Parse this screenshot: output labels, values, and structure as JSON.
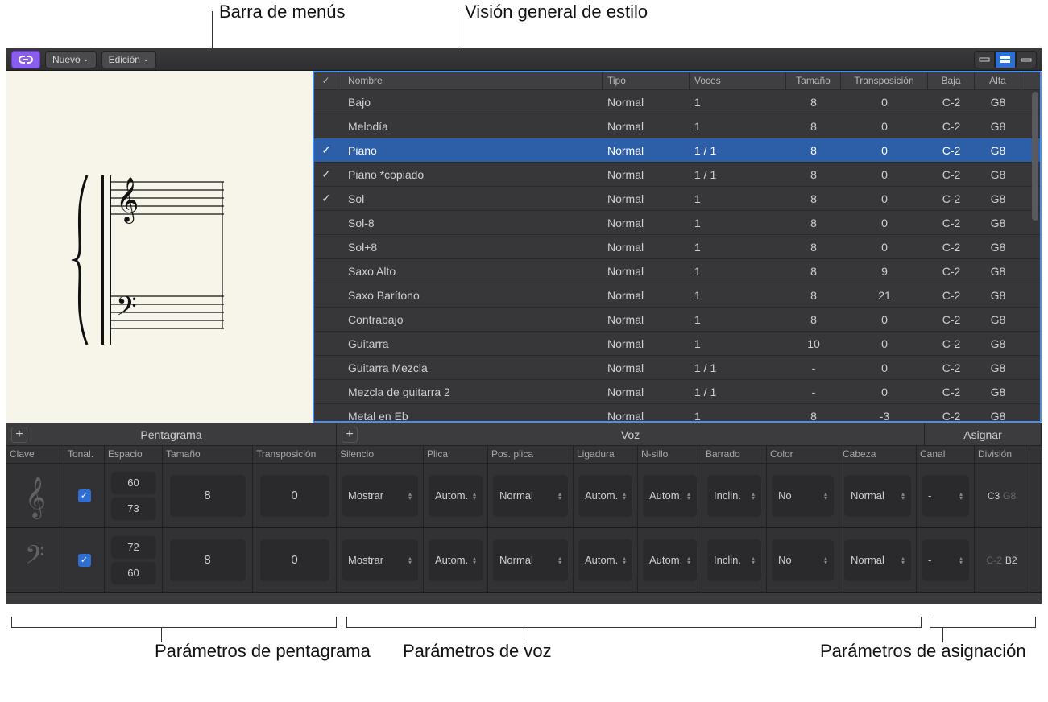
{
  "callouts": {
    "menubar": "Barra de menús",
    "style_overview": "Visión general de estilo",
    "staff_params": "Parámetros de pentagrama",
    "voice_params": "Parámetros de voz",
    "assign_params": "Parámetros de asignación"
  },
  "toolbar": {
    "nuevo": "Nuevo",
    "edicion": "Edición"
  },
  "styles": {
    "headers": {
      "check": "✓",
      "name": "Nombre",
      "type": "Tipo",
      "voices": "Voces",
      "size": "Tamaño",
      "trans": "Transposición",
      "low": "Baja",
      "high": "Alta"
    },
    "rows": [
      {
        "chk": "",
        "name": "Bajo",
        "type": "Normal",
        "voices": "1",
        "size": "8",
        "trans": "0",
        "low": "C-2",
        "high": "G8",
        "sel": false
      },
      {
        "chk": "",
        "name": "Melodía",
        "type": "Normal",
        "voices": "1",
        "size": "8",
        "trans": "0",
        "low": "C-2",
        "high": "G8",
        "sel": false
      },
      {
        "chk": "✓",
        "name": "Piano",
        "type": "Normal",
        "voices": "1 / 1",
        "size": "8",
        "trans": "0",
        "low": "C-2",
        "high": "G8",
        "sel": true
      },
      {
        "chk": "✓",
        "name": "Piano *copiado",
        "type": "Normal",
        "voices": "1 / 1",
        "size": "8",
        "trans": "0",
        "low": "C-2",
        "high": "G8",
        "sel": false
      },
      {
        "chk": "✓",
        "name": "Sol",
        "type": "Normal",
        "voices": "1",
        "size": "8",
        "trans": "0",
        "low": "C-2",
        "high": "G8",
        "sel": false
      },
      {
        "chk": "",
        "name": "Sol-8",
        "type": "Normal",
        "voices": "1",
        "size": "8",
        "trans": "0",
        "low": "C-2",
        "high": "G8",
        "sel": false
      },
      {
        "chk": "",
        "name": "Sol+8",
        "type": "Normal",
        "voices": "1",
        "size": "8",
        "trans": "0",
        "low": "C-2",
        "high": "G8",
        "sel": false
      },
      {
        "chk": "",
        "name": "Saxo Alto",
        "type": "Normal",
        "voices": "1",
        "size": "8",
        "trans": "9",
        "low": "C-2",
        "high": "G8",
        "sel": false
      },
      {
        "chk": "",
        "name": "Saxo Barítono",
        "type": "Normal",
        "voices": "1",
        "size": "8",
        "trans": "21",
        "low": "C-2",
        "high": "G8",
        "sel": false
      },
      {
        "chk": "",
        "name": "Contrabajo",
        "type": "Normal",
        "voices": "1",
        "size": "8",
        "trans": "0",
        "low": "C-2",
        "high": "G8",
        "sel": false
      },
      {
        "chk": "",
        "name": "Guitarra",
        "type": "Normal",
        "voices": "1",
        "size": "10",
        "trans": "0",
        "low": "C-2",
        "high": "G8",
        "sel": false
      },
      {
        "chk": "",
        "name": "Guitarra Mezcla",
        "type": "Normal",
        "voices": "1 / 1",
        "size": "-",
        "trans": "0",
        "low": "C-2",
        "high": "G8",
        "sel": false
      },
      {
        "chk": "",
        "name": "Mezcla de guitarra 2",
        "type": "Normal",
        "voices": "1 / 1",
        "size": "-",
        "trans": "0",
        "low": "C-2",
        "high": "G8",
        "sel": false
      },
      {
        "chk": "",
        "name": "Metal en Eb",
        "type": "Normal",
        "voices": "1",
        "size": "8",
        "trans": "-3",
        "low": "C-2",
        "high": "G8",
        "sel": false
      }
    ]
  },
  "sections": {
    "staff": "Pentagrama",
    "voice": "Voz",
    "assign": "Asignar"
  },
  "param_headers": {
    "clave": "Clave",
    "tonal": "Tonal.",
    "espacio": "Espacio",
    "tam": "Tamaño",
    "trp": "Transposición",
    "sil": "Silencio",
    "pli": "Plica",
    "pos": "Pos. plica",
    "lig": "Ligadura",
    "nsi": "N-sillo",
    "bar": "Barrado",
    "col": "Color",
    "cab": "Cabeza",
    "can": "Canal",
    "div": "División"
  },
  "param_rows": [
    {
      "clef": "treble",
      "tonal": true,
      "esp1": "60",
      "esp2": "73",
      "tam": "8",
      "trp": "0",
      "sil": "Mostrar",
      "pli": "Autom.",
      "pos": "Normal",
      "lig": "Autom.",
      "nsi": "Autom.",
      "bar": "Inclin.",
      "col": "No",
      "cab": "Normal",
      "can": "-",
      "div1": "C3",
      "div2": "G8",
      "div2dim": true
    },
    {
      "clef": "bass",
      "tonal": true,
      "esp1": "72",
      "esp2": "60",
      "tam": "8",
      "trp": "0",
      "sil": "Mostrar",
      "pli": "Autom.",
      "pos": "Normal",
      "lig": "Autom.",
      "nsi": "Autom.",
      "bar": "Inclin.",
      "col": "No",
      "cab": "Normal",
      "can": "-",
      "div1": "C-2",
      "div2": "B2",
      "div1dim": true
    }
  ]
}
